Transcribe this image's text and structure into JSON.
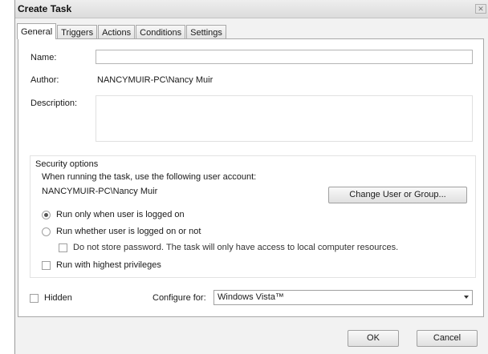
{
  "window": {
    "title": "Create Task",
    "close_glyph": "✕"
  },
  "tabs": [
    {
      "label": "General",
      "active": true
    },
    {
      "label": "Triggers"
    },
    {
      "label": "Actions"
    },
    {
      "label": "Conditions"
    },
    {
      "label": "Settings"
    }
  ],
  "general": {
    "name_label": "Name:",
    "name_value": "",
    "author_label": "Author:",
    "author_value": "NANCYMUIR-PC\\Nancy Muir",
    "description_label": "Description:",
    "description_value": ""
  },
  "security": {
    "heading": "Security options",
    "account_prompt": "When running the task, use the following user account:",
    "account_value": "NANCYMUIR-PC\\Nancy Muir",
    "change_button": "Change User or Group...",
    "radio_logged_on": "Run only when user is logged on",
    "radio_logged_on_checked": true,
    "radio_whether": "Run whether user is logged on or not",
    "no_store_password": "Do not store password.  The task will only have access to local computer resources.",
    "highest_privileges": "Run with highest privileges"
  },
  "footer": {
    "hidden_label": "Hidden",
    "configure_label": "Configure for:",
    "configure_value": "Windows Vista™"
  },
  "buttons": {
    "ok": "OK",
    "cancel": "Cancel"
  }
}
